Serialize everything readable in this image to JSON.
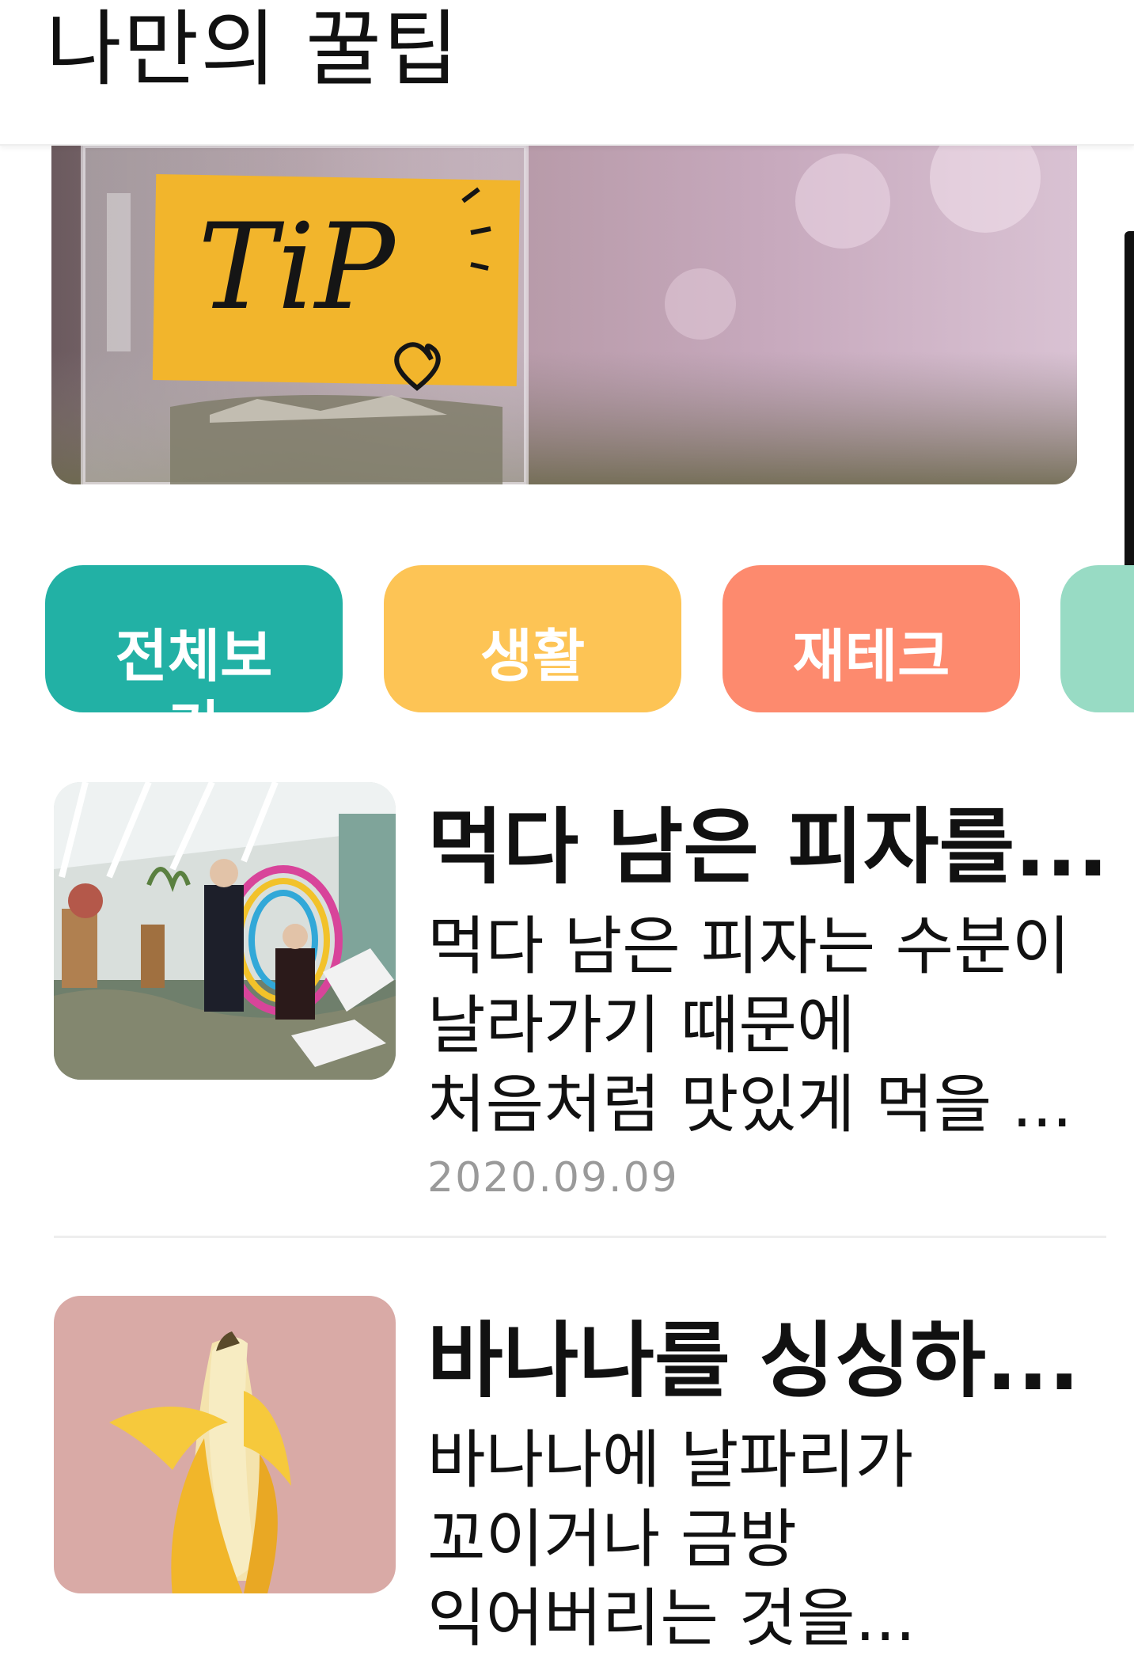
{
  "header": {
    "title": "나만의 꿀팁"
  },
  "banner": {
    "tag_text": "TiP"
  },
  "categories": [
    {
      "label": "전체보기",
      "color": "#22b1a5"
    },
    {
      "label": "생활",
      "color": "#fdc455"
    },
    {
      "label": "재테크",
      "color": "#fd8a6e"
    },
    {
      "label": "",
      "color": "#98dbc4"
    }
  ],
  "posts": [
    {
      "title": "먹다 남은 피자를...",
      "desc_lines": [
        "먹다 남은 피자는 수분이",
        "날라가기 때문에",
        "처음처럼 맛있게 먹을 ..."
      ],
      "date": "2020.09.09"
    },
    {
      "title": "바나나를 싱싱하...",
      "desc_lines": [
        "바나나에 날파리가",
        "꼬이거나 금방",
        "익어버리는 것을..."
      ]
    }
  ]
}
